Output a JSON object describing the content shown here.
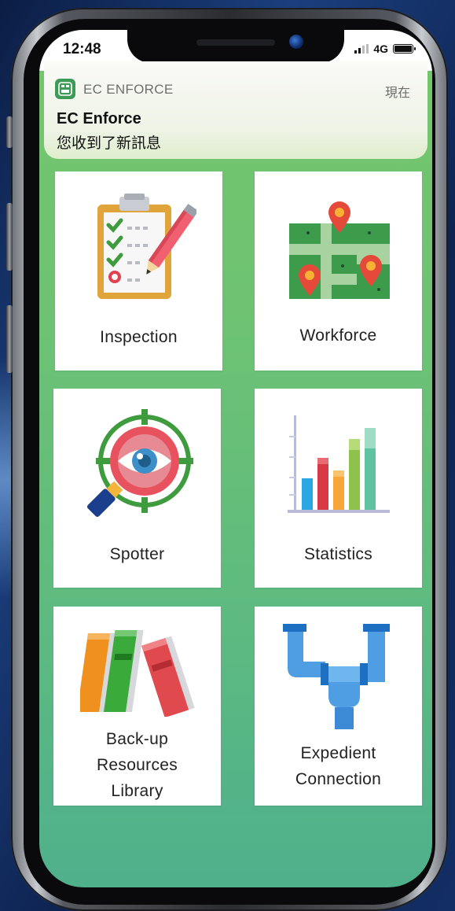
{
  "status_bar": {
    "time": "12:48",
    "network": "4G"
  },
  "notification": {
    "app_name": "EC ENFORCE",
    "time": "現在",
    "title": "EC Enforce",
    "body": "您收到了新訊息"
  },
  "tiles": [
    {
      "label": "Inspection",
      "icon": "clipboard-checklist-icon"
    },
    {
      "label": "Workforce",
      "icon": "map-pins-icon"
    },
    {
      "label": "Spotter",
      "icon": "eye-target-magnifier-icon"
    },
    {
      "label": "Statistics",
      "icon": "bar-chart-icon"
    },
    {
      "label_lines": [
        "Back-up",
        "Resources",
        "Library"
      ],
      "icon": "books-icon"
    },
    {
      "label_lines": [
        "Expedient",
        "Connection"
      ],
      "icon": "pipe-connection-icon"
    }
  ],
  "colors": {
    "screen_green": "#6dc273",
    "tile_bg": "#ffffff",
    "app_icon": "#3e9b57"
  }
}
